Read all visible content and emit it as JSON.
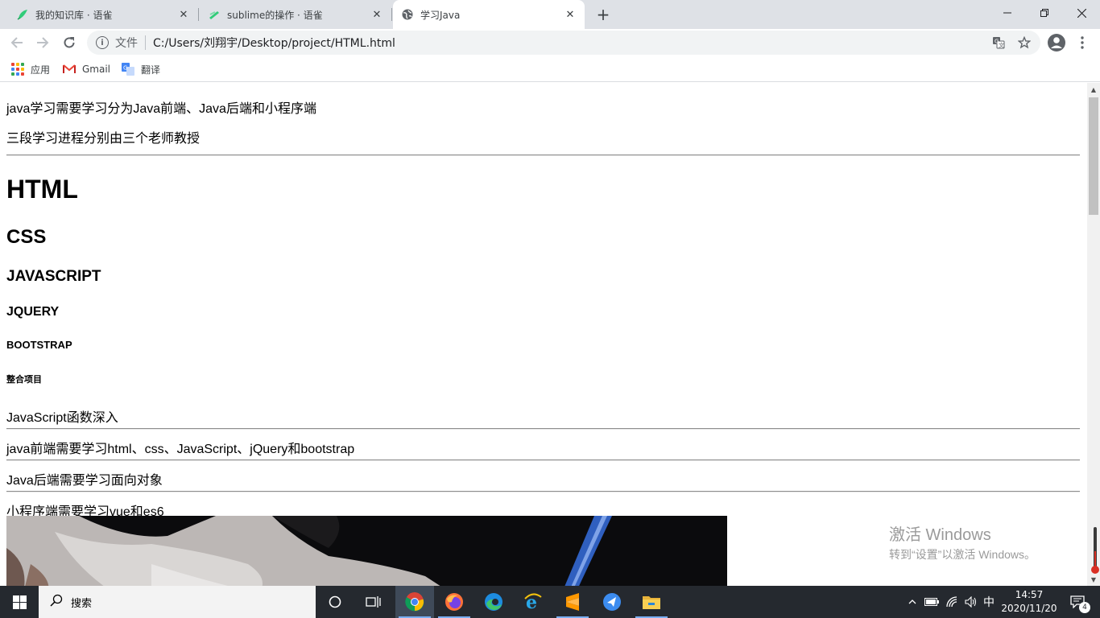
{
  "browser": {
    "tabs": [
      {
        "title": "我的知识库 · 语雀",
        "favicon": "yuque-icon"
      },
      {
        "title": "sublime的操作 · 语雀",
        "favicon": "yuque-doc-icon"
      },
      {
        "title": "学习Java",
        "favicon": "globe-icon"
      }
    ],
    "active_tab_index": 2,
    "new_tab_symbol": "+",
    "omnibox": {
      "security_label": "文件",
      "url": "C:/Users/刘翔宇/Desktop/project/HTML.html"
    },
    "bookmarks": [
      {
        "label": "应用",
        "icon": "apps-grid-icon"
      },
      {
        "label": "Gmail",
        "icon": "gmail-icon"
      },
      {
        "label": "翻译",
        "icon": "translate-icon"
      }
    ]
  },
  "page": {
    "intro_line_1": "java学习需要学习分为Java前端、Java后端和小程序端",
    "intro_line_2": "三段学习进程分别由三个老师教授",
    "headings": {
      "h1": "HTML",
      "h2": "CSS",
      "h3": "JAVASCRIPT",
      "h4": "JQUERY",
      "h5": "BOOTSTRAP",
      "h6": "整合项目"
    },
    "lines": [
      "JavaScript函数深入",
      "java前端需要学习html、css、JavaScript、jQuery和bootstrap",
      "Java后端需要学习面向对象",
      "小程序端需要学习vue和es6"
    ],
    "watermark_line_1": "激活 Windows",
    "watermark_line_2": "转到“设置”以激活 Windows。"
  },
  "taskbar": {
    "search_label": "搜索",
    "ime_label": "中",
    "clock_time": "14:57",
    "clock_date": "2020/11/20",
    "notification_count": "4",
    "apps": [
      "cortana-icon",
      "task-view-icon",
      "chrome-icon",
      "firefox-icon",
      "edge-icon",
      "ie-icon",
      "sublime-icon",
      "feishu-icon",
      "file-explorer-icon"
    ]
  },
  "colors": {
    "tabstrip_bg": "#dee1e6",
    "omnibox_bg": "#f1f3f4",
    "taskbar_bg": "#25292f",
    "active_taskbar_bg": "#3f4a59"
  }
}
